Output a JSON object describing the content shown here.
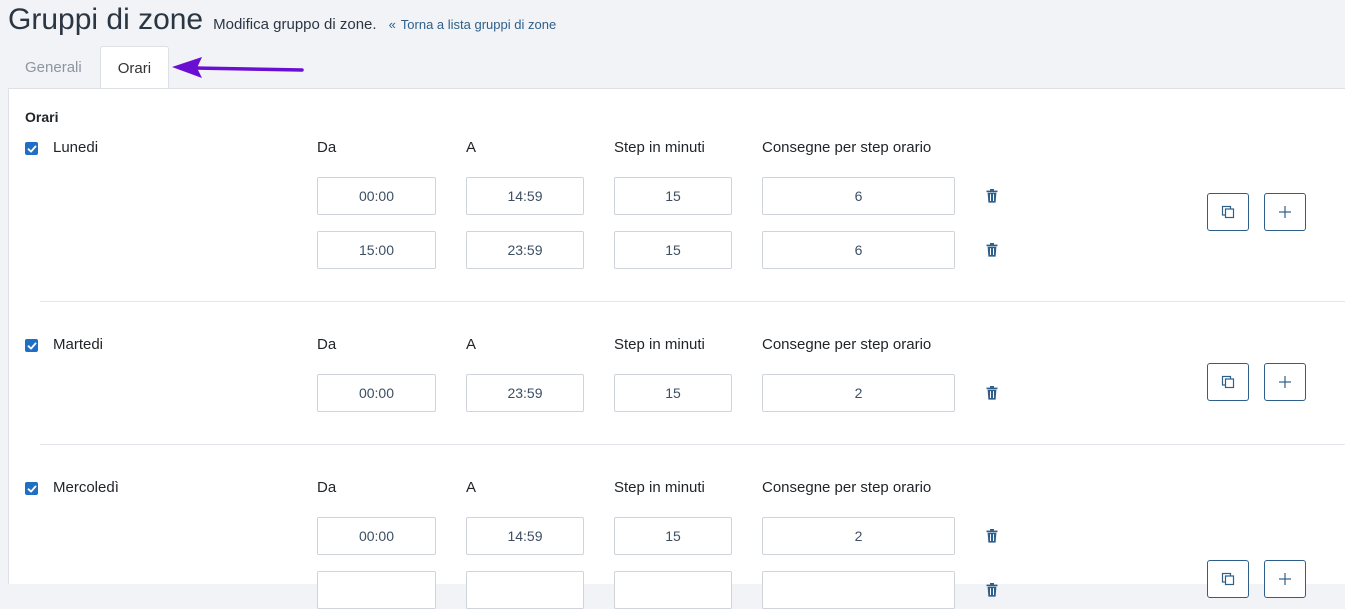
{
  "header": {
    "title": "Gruppi di zone",
    "subtitle": "Modifica gruppo di zone.",
    "back_link": "Torna a lista gruppi di zone"
  },
  "tabs": [
    {
      "label": "Generali",
      "active": false
    },
    {
      "label": "Orari",
      "active": true
    }
  ],
  "colors": {
    "accent": "#2e5f8a",
    "checkbox": "#1f6fc5",
    "annotation_arrow": "#6a0fd1"
  },
  "section": {
    "title": "Orari",
    "columns": {
      "da": "Da",
      "a": "A",
      "step": "Step in minuti",
      "consegne": "Consegne per step orario"
    }
  },
  "days": [
    {
      "name": "Lunedi",
      "checked": true,
      "rows": [
        {
          "da": "00:00",
          "a": "14:59",
          "step": "15",
          "consegne": "6"
        },
        {
          "da": "15:00",
          "a": "23:59",
          "step": "15",
          "consegne": "6"
        }
      ]
    },
    {
      "name": "Martedi",
      "checked": true,
      "rows": [
        {
          "da": "00:00",
          "a": "23:59",
          "step": "15",
          "consegne": "2"
        }
      ]
    },
    {
      "name": "Mercoledì",
      "checked": true,
      "rows": [
        {
          "da": "00:00",
          "a": "14:59",
          "step": "15",
          "consegne": "2"
        },
        {
          "da": "",
          "a": "",
          "step": "",
          "consegne": ""
        }
      ]
    }
  ],
  "icons": {
    "checkbox": "check-icon",
    "delete": "trash-icon",
    "copy": "copy-icon",
    "add": "plus-icon",
    "back": "double-chevron-left-icon"
  }
}
